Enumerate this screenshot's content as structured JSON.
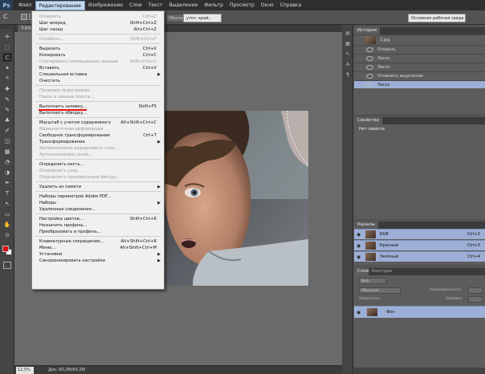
{
  "app": {
    "logo": "Ps"
  },
  "menubar": [
    "Файл",
    "Редактирование",
    "Изображение",
    "Слои",
    "Текст",
    "Выделение",
    "Фильтр",
    "Просмотр",
    "Окно",
    "Справка"
  ],
  "menubar_active": "Редактирование",
  "options": {
    "style_value": "Обычный",
    "preset_label": "уточ. край...",
    "workspace": "Основная рабочая среда"
  },
  "document_tab": "3.jpg @ ...",
  "status": {
    "zoom": "12,5%",
    "doc": "Док: 60,2M/60,2M"
  },
  "edit_menu": [
    {
      "label": "Отменить",
      "shortcut": "Ctrl+Z",
      "disabled": true
    },
    {
      "label": "Шаг вперед",
      "shortcut": "Shift+Ctrl+Z",
      "disabled": false
    },
    {
      "label": "Шаг назад",
      "shortcut": "Alt+Ctrl+Z",
      "disabled": false
    },
    {
      "sep": true
    },
    {
      "label": "Ослабить...",
      "shortcut": "Shift+Ctrl+F",
      "disabled": true
    },
    {
      "sep": true
    },
    {
      "label": "Вырезать",
      "shortcut": "Ctrl+X",
      "disabled": false
    },
    {
      "label": "Копировать",
      "shortcut": "Ctrl+C",
      "disabled": false
    },
    {
      "label": "Скопировать совмещенные данные",
      "shortcut": "Shift+Ctrl+C",
      "disabled": true
    },
    {
      "label": "Вставить",
      "shortcut": "Ctrl+V",
      "disabled": false
    },
    {
      "label": "Специальная вставка",
      "submenu": true,
      "disabled": false
    },
    {
      "label": "Очистить",
      "disabled": false
    },
    {
      "sep": true
    },
    {
      "label": "Проверка орфографии...",
      "disabled": true
    },
    {
      "label": "Поиск и замена текста...",
      "disabled": true
    },
    {
      "sep": true
    },
    {
      "label": "Выполнить заливку...",
      "shortcut": "Shift+F5",
      "disabled": false
    },
    {
      "label": "Выполнить обводку...",
      "disabled": false
    },
    {
      "sep": true
    },
    {
      "label": "Масштаб с учетом содержимого",
      "shortcut": "Alt+Shift+Ctrl+C",
      "disabled": false
    },
    {
      "label": "Марионеточная деформация",
      "disabled": true
    },
    {
      "label": "Свободное трансформирование",
      "shortcut": "Ctrl+T",
      "disabled": false
    },
    {
      "label": "Трансформирование",
      "submenu": true,
      "disabled": false
    },
    {
      "label": "Автоматически выравнивать слои...",
      "disabled": true
    },
    {
      "label": "Автоналожение слоев...",
      "disabled": true
    },
    {
      "sep": true
    },
    {
      "label": "Определить кисть...",
      "disabled": false
    },
    {
      "label": "Определить узор...",
      "disabled": true
    },
    {
      "label": "Определить произвольную фигуру...",
      "disabled": true
    },
    {
      "sep": true
    },
    {
      "label": "Удалить из памяти",
      "submenu": true,
      "disabled": false
    },
    {
      "sep": true
    },
    {
      "label": "Наборы параметров Adobe PDF...",
      "disabled": false
    },
    {
      "label": "Наборы",
      "submenu": true,
      "disabled": false
    },
    {
      "label": "Удаленные соединения...",
      "disabled": false
    },
    {
      "sep": true
    },
    {
      "label": "Настройка цветов...",
      "shortcut": "Shift+Ctrl+K",
      "disabled": false
    },
    {
      "label": "Назначить профиль...",
      "disabled": false
    },
    {
      "label": "Преобразовать в профиль...",
      "disabled": false
    },
    {
      "sep": true
    },
    {
      "label": "Клавиатурные сокращения...",
      "shortcut": "Alt+Shift+Ctrl+K",
      "disabled": false
    },
    {
      "label": "Меню...",
      "shortcut": "Alt+Shift+Ctrl+M",
      "disabled": false
    },
    {
      "label": "Установки",
      "submenu": true,
      "disabled": false
    },
    {
      "label": "Синхронизировать настройки",
      "submenu": true,
      "disabled": false
    }
  ],
  "history": {
    "title": "История",
    "snapshot": "3.jpg",
    "items": [
      "Открыть",
      "Лассо",
      "Лассо",
      "Отменить выделение",
      "Лассо"
    ]
  },
  "properties": {
    "title": "Свойства",
    "text": "Нет свойств"
  },
  "channels": {
    "title": "Каналы",
    "items": [
      {
        "name": "RGB",
        "shortcut": "Ctrl+2"
      },
      {
        "name": "Красный",
        "shortcut": "Ctrl+3"
      },
      {
        "name": "Зеленый",
        "shortcut": "Ctrl+4"
      }
    ]
  },
  "layers": {
    "tabs": [
      "Слои",
      "Контуры"
    ],
    "filter": "Вид",
    "blend": "Обычные",
    "opacity_label": "Непрозрачность:",
    "lock_label": "Закрепить:",
    "fill_label": "Заливка:",
    "layer_name": "Фон"
  },
  "colors": {
    "fg": "#e01010",
    "bg": "#ffffff",
    "menu_active": "#c3d8ee",
    "selected_row": "#9dafd6"
  }
}
